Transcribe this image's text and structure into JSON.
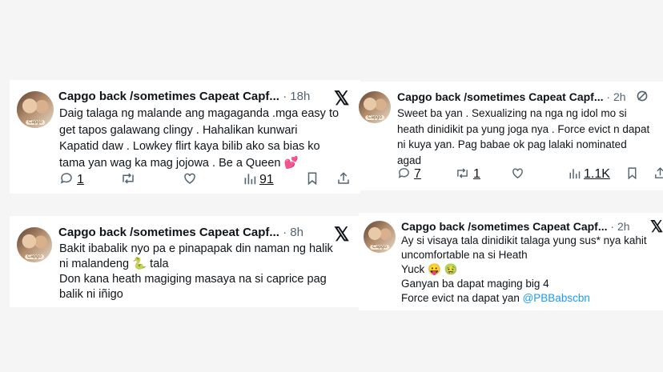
{
  "tweets": [
    {
      "name": "Capgo back /sometimes Capeat Capf...",
      "dot": "·",
      "time": "18h",
      "body": "Daig talaga ng malande ang magaganda .mga easy to\nget tapos galawang clingy . Hahalikan kunwari\nKapatid daw . Lowkey flirt kaya bilib ako sa bias ko\ntama yan wag ka mag jojowa . Be a Queen 💕",
      "replies": "1",
      "retweets": "",
      "views": "91",
      "avatar_tag": "Capgo"
    },
    {
      "name": "Capgo back /sometimes Capeat Capf...",
      "dot": "·",
      "time": "2h",
      "body": "Sweet ba yan . Sexualizing na nga ng idol mo si\nheath dinidikit pa yung joga nya . Force evict n dapat\nni kuya yan.  Pag babae ok pag lalaki nominated\nagad",
      "replies": "7",
      "retweets": "1",
      "views": "1.1K",
      "avatar_tag": "Capgo"
    },
    {
      "name": "Capgo back /sometimes Capeat Capf...",
      "dot": "·",
      "time": "8h",
      "body": "Bakit ibabalik nyo pa e pinapapak din naman ng halik\nni malandeng 🐍 tala\nDon kana heath magiging masaya na si caprice pag\nbalik ni iñigo",
      "avatar_tag": "Capgo"
    },
    {
      "name": "Capgo back /sometimes Capeat Capf...",
      "dot": "·",
      "time": "2h",
      "body_lines": [
        "Ay si visaya tala  dinidikit talaga yung sus* nya kahit",
        "uncomfortable na si Heath",
        "Yuck 😛 🤢",
        "Ganyan ba dapat maging big 4"
      ],
      "body_last_prefix": "Force evict na dapat yan ",
      "mention": "@PBBabscbn",
      "avatar_tag": "Capgo"
    }
  ],
  "icons": {
    "x_logo": "𝕏",
    "grok": "⊘",
    "reply": "🗨",
    "retweet": "⇄",
    "like": "♡",
    "views": "📊",
    "bookmark": "🔖",
    "share": "⇪"
  }
}
